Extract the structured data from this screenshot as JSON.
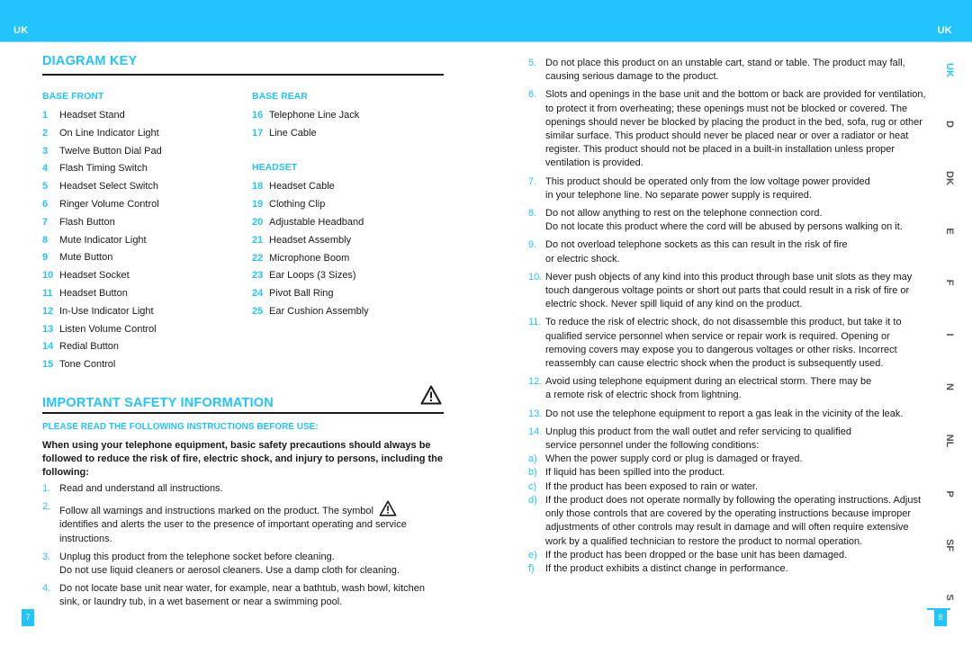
{
  "header": {
    "left_tag": "UK",
    "right_tag": "UK",
    "accent_color": "#22c4ff"
  },
  "diagram_key": {
    "title": "DIAGRAM KEY",
    "base_front": {
      "heading": "BASE FRONT",
      "items": [
        {
          "num": "1",
          "label": "Headset Stand"
        },
        {
          "num": "2",
          "label": "On Line Indicator Light"
        },
        {
          "num": "3",
          "label": "Twelve Button Dial Pad"
        },
        {
          "num": "4",
          "label": "Flash Timing Switch"
        },
        {
          "num": "5",
          "label": "Headset Select Switch"
        },
        {
          "num": "6",
          "label": "Ringer Volume Control"
        },
        {
          "num": "7",
          "label": "Flash Button"
        },
        {
          "num": "8",
          "label": "Mute Indicator Light"
        },
        {
          "num": "9",
          "label": "Mute Button"
        },
        {
          "num": "10",
          "label": "Headset Socket"
        },
        {
          "num": "11",
          "label": "Headset Button"
        },
        {
          "num": "12",
          "label": "In-Use Indicator Light"
        },
        {
          "num": "13",
          "label": "Listen Volume Control"
        },
        {
          "num": "14",
          "label": "Redial Button"
        },
        {
          "num": "15",
          "label": "Tone Control"
        }
      ]
    },
    "base_rear": {
      "heading": "BASE REAR",
      "items": [
        {
          "num": "16",
          "label": "Telephone Line Jack"
        },
        {
          "num": "17",
          "label": "Line Cable"
        }
      ]
    },
    "headset": {
      "heading": "HEADSET",
      "items": [
        {
          "num": "18",
          "label": "Headset Cable"
        },
        {
          "num": "19",
          "label": "Clothing Clip"
        },
        {
          "num": "20",
          "label": "Adjustable Headband"
        },
        {
          "num": "21",
          "label": "Headset Assembly"
        },
        {
          "num": "22",
          "label": "Microphone Boom"
        },
        {
          "num": "23",
          "label": "Ear Loops (3 Sizes)"
        },
        {
          "num": "24",
          "label": "Pivot Ball Ring"
        },
        {
          "num": "25",
          "label": "Ear Cushion Assembly"
        }
      ]
    }
  },
  "safety": {
    "title": "IMPORTANT SAFETY INFORMATION",
    "icon": "warning-triangle-icon",
    "subheading": "PLEASE READ THE FOLLOWING INSTRUCTIONS BEFORE USE:",
    "intro": "When using your telephone equipment, basic safety precautions should always be followed to reduce the risk of fire, electric shock, and injury to persons, including the following:",
    "items": [
      {
        "num": "1.",
        "text": "Read and understand all instructions."
      },
      {
        "num": "2.",
        "text": "Follow all warnings and instructions marked on the product. The symbol",
        "text_after": "identifies and alerts the user to the presence of important operating and service instructions."
      },
      {
        "num": "3.",
        "text": "Unplug this product from the telephone socket before cleaning.",
        "text2": "Do not use liquid cleaners or aerosol cleaners. Use a damp cloth for cleaning."
      },
      {
        "num": "4.",
        "text": "Do not locate base unit near water, for example, near a bathtub, wash bowl, kitchen sink, or laundry tub, in a wet basement or near a swimming pool."
      },
      {
        "num": "5.",
        "text": "Do not place this product on an unstable cart, stand or table. The product may fall, causing serious damage to the product."
      },
      {
        "num": "6.",
        "text": "Slots and openings in the base unit and the bottom or back are provided for ventilation, to protect it from overheating; these openings must not be blocked or covered. The openings should never be blocked by placing the product in the bed, sofa, rug or other similar surface. This product should never be placed near or over a radiator or heat register. This product should not be placed in a built-in installation unless proper ventilation is provided."
      },
      {
        "num": "7.",
        "text": "This product should be operated only from the low voltage power provided",
        "text2": "in your telephone line. No separate power supply is required."
      },
      {
        "num": "8.",
        "text": "Do not allow anything to rest on the telephone connection cord.",
        "text2": "Do not locate this product where the cord will be abused by persons walking on it."
      },
      {
        "num": "9.",
        "text": "Do not overload telephone sockets as this can result in the risk of fire",
        "text2": "or electric shock."
      },
      {
        "num": "10.",
        "text": "Never push objects of any kind into this product through base unit slots as they may touch dangerous voltage points or short out parts that could result in a risk of fire or electric shock. Never spill liquid of any kind on the product."
      },
      {
        "num": "11.",
        "text": "To reduce the risk of electric shock, do not disassemble this product, but take it to qualified service personnel when service or repair work is required. Opening or removing covers may expose you to dangerous voltages or other risks. Incorrect reassembly can cause electric shock when the product is subsequently used."
      },
      {
        "num": "12.",
        "text": "Avoid using telephone equipment during an electrical storm. There may be",
        "text2": "a remote risk of electric shock from lightning."
      },
      {
        "num": "13.",
        "text": "Do not use the telephone equipment to report a gas leak in the vicinity of the leak."
      },
      {
        "num": "14.",
        "text": "Unplug this product from the wall outlet and refer servicing to qualified",
        "text2": "service personnel under the following conditions:"
      }
    ],
    "conditions": [
      {
        "letter": "a)",
        "text": "When the power supply cord or plug is damaged or frayed."
      },
      {
        "letter": "b)",
        "text": " If liquid has been spilled into the product."
      },
      {
        "letter": "c)",
        "text": "If the product has been exposed to rain or water."
      },
      {
        "letter": "d)",
        "text": "If the product does not operate normally by following the operating instructions. Adjust only those controls that are covered by the operating instructions because improper adjustments of other controls may result in damage and will often require extensive work by a qualified technician to restore the product to normal operation."
      },
      {
        "letter": "e)",
        "text": "If the product has been dropped or the base unit has been damaged."
      },
      {
        "letter": "f)",
        "text": "If the product exhibits a distinct change in performance."
      }
    ]
  },
  "language_tabs": [
    {
      "label": "UK",
      "active": true
    },
    {
      "label": "D"
    },
    {
      "label": "DK"
    },
    {
      "label": "E"
    },
    {
      "label": "F"
    },
    {
      "label": "I"
    },
    {
      "label": "N"
    },
    {
      "label": "NL"
    },
    {
      "label": "P"
    },
    {
      "label": "SF"
    },
    {
      "label": "S"
    }
  ],
  "page_numbers": {
    "left": "7",
    "right": "8"
  }
}
